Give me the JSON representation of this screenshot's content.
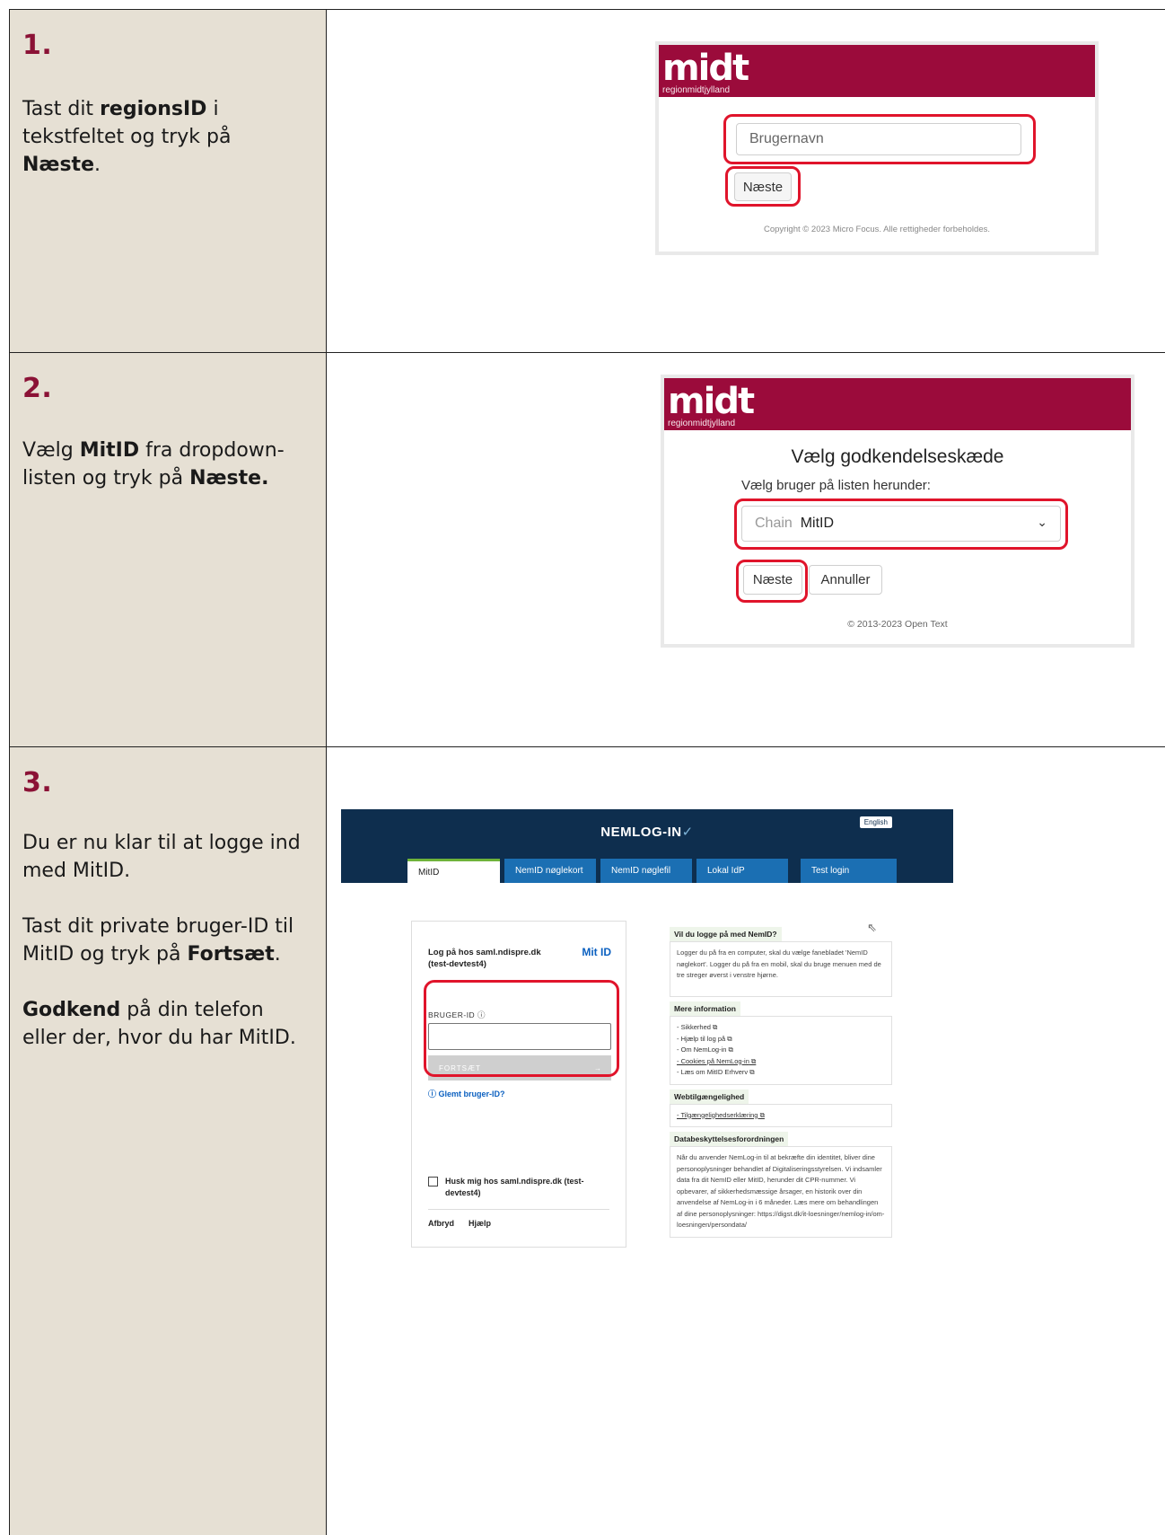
{
  "steps": [
    {
      "number": "1.",
      "line1_pre": "Tast dit ",
      "line1_bold": "regionsID",
      "line1_post": " i tekstfeltet og tryk på ",
      "line1_bold2": "Næste",
      "line1_end": "."
    },
    {
      "number": "2.",
      "pre": "Vælg ",
      "bold1": "MitID",
      "mid": " fra dropdown-listen og tryk på ",
      "bold2": "Næste."
    },
    {
      "number": "3.",
      "p1": "Du er nu klar til at logge ind med MitID.",
      "p2_pre": "Tast dit private bruger-ID til MitID og tryk på ",
      "p2_bold": "Fortsæt",
      "p2_end": ".",
      "p3_bold": "Godkend",
      "p3_rest": " på din telefon eller der, hvor du har MitID."
    }
  ],
  "login1": {
    "logo": "midt",
    "sublogo": "regionmidtjylland",
    "username_placeholder": "Brugernavn",
    "next_label": "Næste",
    "copyright": "Copyright © 2023 Micro Focus. Alle rettigheder forbeholdes."
  },
  "login2": {
    "logo": "midt",
    "sublogo": "regionmidtjylland",
    "heading": "Vælg godkendelseskæde",
    "subheading": "Vælg bruger på listen herunder:",
    "select_prefix": "Chain",
    "select_value": "MitID",
    "next_label": "Næste",
    "cancel_label": "Annuller",
    "copyright": "© 2013-2023 Open Text"
  },
  "nemlogin": {
    "title": "NEMLOG-IN",
    "english": "English",
    "tabs": [
      "MitID",
      "NemID nøglekort",
      "NemID nøglefil",
      "Lokal IdP",
      "Test login"
    ],
    "card": {
      "heading": "Log på hos saml.ndispre.dk (test-devtest4)",
      "logo": "Mit ID",
      "label": "BRUGER-ID ⓘ",
      "continue": "FORTSÆT",
      "forgot": "Glemt bruger-ID?",
      "remember": "Husk mig hos saml.ndispre.dk (test-devtest4)",
      "cancel": "Afbryd",
      "help": "Hjælp"
    },
    "sections": [
      {
        "head": "Vil du logge på med NemID?",
        "body": "Logger du på fra en computer, skal du vælge fanebladet 'NemID nøglekort'. Logger du på fra en mobil, skal du bruge menuen med de tre streger øverst i venstre hjørne."
      },
      {
        "head": "Mere information",
        "links": [
          "- Sikkerhed",
          "- Hjælp til log på",
          "- Om NemLog-in",
          "- Cookies på NemLog-in",
          "- Læs om MitID Erhverv"
        ]
      },
      {
        "head": "Webtilgængelighed",
        "links": [
          "- Tilgængelighedserklæring"
        ]
      },
      {
        "head": "Databeskyttelsesforordningen",
        "body": "Når du anvender NemLog-in til at bekræfte din identitet, bliver dine personoplysninger behandlet af Digitaliseringsstyrelsen. Vi indsamler data fra dit NemID eller MitID, herunder dit CPR-nummer. Vi opbevarer, af sikkerhedsmæssige årsager, en historik over din anvendelse af NemLog-in i 6 måneder. Læs mere om behandlingen af dine personoplysninger: https://digst.dk/it-loesninger/nemlog-in/om-loesningen/persondata/"
      }
    ]
  }
}
